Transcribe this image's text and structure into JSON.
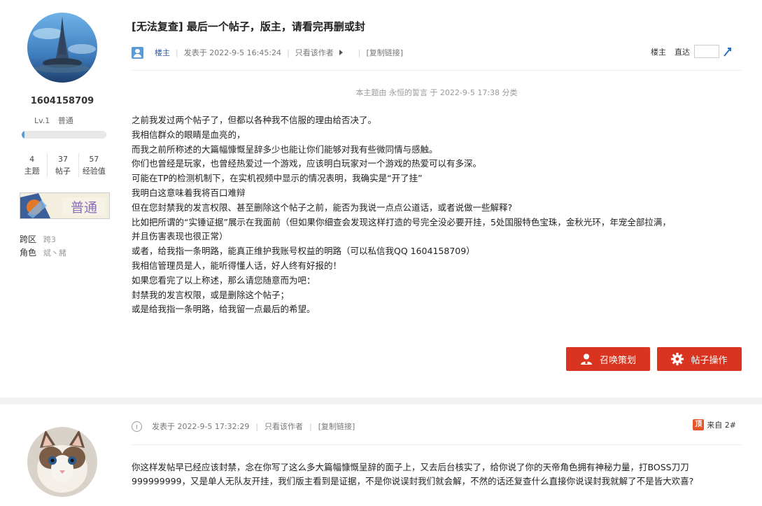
{
  "post1": {
    "user": {
      "name": "1604158709",
      "level": "Lv.1",
      "rank": "普通",
      "level_progress": 0.03,
      "stats": [
        {
          "value": "4",
          "label": "主题"
        },
        {
          "value": "37",
          "label": "帖子"
        },
        {
          "value": "57",
          "label": "经验值"
        }
      ],
      "badge_text": "普通",
      "server_key": "跨区",
      "server_val": "跨3",
      "role_key": "角色",
      "role_val": "斌丶赭"
    },
    "title": "[无法复查] 最后一个帖子，版主，请看完再删或封",
    "info": {
      "floor_owner": "楼主",
      "posted": "发表于 2022-9-5 16:45:24",
      "only_author": "只看该作者",
      "copy_link": "[复制链接]",
      "right_owner": "楼主",
      "jump_label": "直达"
    },
    "edit_note": "本主题由 永恒的誓言 于 2022-9-5 17:38 分类",
    "body": [
      "之前我发过两个帖子了，但都以各种我不信服的理由给否决了。",
      "我相信群众的眼睛是血亮的，",
      "而我之前所称述的大篇幅慷慨呈辞多少也能让你们能够对我有些微同情与感触。",
      "你们也曾经是玩家，也曾经热爱过一个游戏，应该明白玩家对一个游戏的热爱可以有多深。",
      "可能在TP的检测机制下，在实机视频中显示的情况表明，我确实是“开了挂”",
      "我明白这意味着我将百口难辩",
      "但在您封禁我的发言权限、甚至删除这个帖子之前，能否为我说一点点公道话，或者说做一些解释?",
      "比如把所谓的“实锤证据”展示在我面前（但如果你细查会发现这样打造的号完全没必要开挂，5处国服特色宝珠，金秋光环，年宠全部拉满，",
      "并且伤害表现也很正常）",
      "或者，给我指一条明路，能真正维护我账号权益的明路（可以私信我QQ 1604158709）",
      "我相信管理员是人，能听得懂人话，好人终有好报的！",
      "如果您看完了以上称述，那么请您随意而为吧：",
      "封禁我的发言权限，或是删除这个帖子；",
      "或是给我指一条明路，给我留一点最后的希望。"
    ],
    "buttons": {
      "summon": "召唤策划",
      "ops": "帖子操作"
    }
  },
  "post2": {
    "posted": "发表于 2022-9-5 17:32:29",
    "only_author": "只看该作者",
    "copy_link": "[复制链接]",
    "ding": "顶",
    "floor": "来自 2#",
    "body": "你这样发帖早已经应该封禁，念在你写了这么多大篇幅慷慨呈辞的面子上，又去后台核实了，给你说了你的天帝角色拥有神秘力量，打BOSS刀刀999999999，又是单人无队友开挂，我们版主看到是证据，不是你说误封我们就会解，不然的话还复查什么直接你说误封我就解了不是皆大欢喜?"
  },
  "colors": {
    "accent_red": "#d8341f",
    "link_blue": "#2a5caa",
    "progress_blue": "#5b9bd5"
  }
}
